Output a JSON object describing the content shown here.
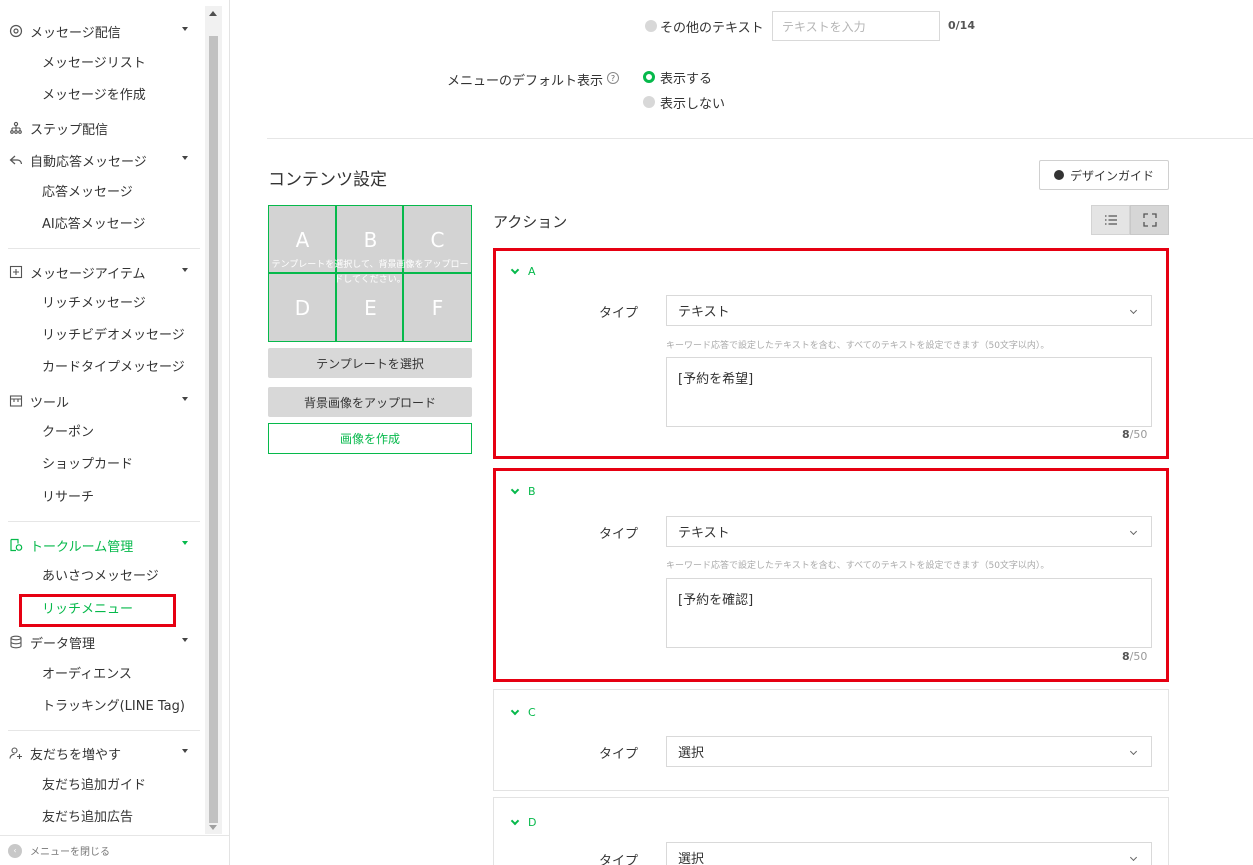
{
  "sidebar": {
    "message_section": "メッセージ配信",
    "message_list": "メッセージリスト",
    "message_create": "メッセージを作成",
    "step_section": "ステップ配信",
    "auto_section": "自動応答メッセージ",
    "auto_reply": "応答メッセージ",
    "ai_reply": "AI応答メッセージ",
    "item_section": "メッセージアイテム",
    "rich_message": "リッチメッセージ",
    "rich_video": "リッチビデオメッセージ",
    "card_message": "カードタイプメッセージ",
    "tool_section": "ツール",
    "coupon": "クーポン",
    "shop_card": "ショップカード",
    "research": "リサーチ",
    "talkroom_section": "トークルーム管理",
    "greeting": "あいさつメッセージ",
    "rich_menu": "リッチメニュー",
    "data_section": "データ管理",
    "audience": "オーディエンス",
    "tracking": "トラッキング(LINE Tag)",
    "friends_section": "友だちを増やす",
    "friend_guide": "友だち追加ガイド",
    "friend_ads": "友だち追加広告",
    "close_menu": "メニューを閉じる"
  },
  "menu_bar": {
    "other_text_label": "その他のテキスト",
    "other_text_placeholder": "テキストを入力",
    "other_text_counter": "0/14"
  },
  "default_display": {
    "label": "メニューのデフォルト表示",
    "help": "?",
    "option_show": "表示する",
    "option_hide": "表示しない"
  },
  "content": {
    "title": "コンテンツ設定",
    "design_guide": "デザインガイド",
    "template_cells": [
      "A",
      "B",
      "C",
      "D",
      "E",
      "F"
    ],
    "template_hint": "テンプレートを選択して、背景画像をアップロードしてください。",
    "select_template": "テンプレートを選択",
    "upload_bg": "背景画像をアップロード",
    "create_image": "画像を作成",
    "action_title": "アクション"
  },
  "actions": [
    {
      "label": "A",
      "type_label": "タイプ",
      "type_value": "テキスト",
      "hint": "キーワード応答で設定したテキストを含む、すべてのテキストを設定できます（50文字以内）。",
      "text": "[予約を希望]",
      "count": "8",
      "max": "/50"
    },
    {
      "label": "B",
      "type_label": "タイプ",
      "type_value": "テキスト",
      "hint": "キーワード応答で設定したテキストを含む、すべてのテキストを設定できます（50文字以内）。",
      "text": "[予約を確認]",
      "count": "8",
      "max": "/50"
    },
    {
      "label": "C",
      "type_label": "タイプ",
      "type_value": "選択"
    },
    {
      "label": "D",
      "type_label": "タイプ",
      "type_value": "選択"
    }
  ],
  "colors": {
    "accent": "#06b94b",
    "highlight": "#e60012"
  }
}
